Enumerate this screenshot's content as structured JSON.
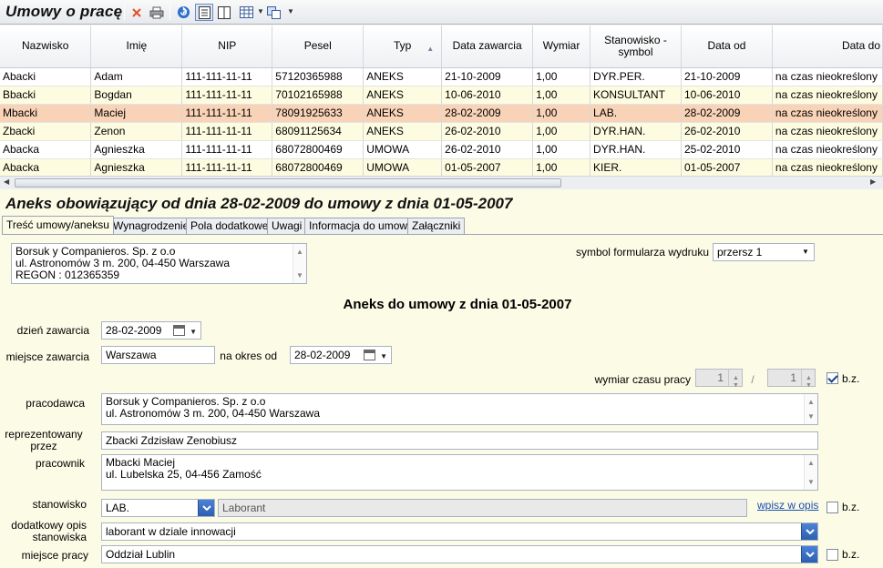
{
  "app_title": "Umowy o pracę",
  "grid": {
    "columns": [
      "Nazwisko",
      "Imię",
      "NIP",
      "Pesel",
      "Typ",
      "Data zawarcia",
      "Wymiar",
      "Stanowisko -\nsymbol",
      "Data od",
      "Data do"
    ],
    "rows": [
      [
        "Abacki",
        "Adam",
        "111-111-11-11",
        "57120365988",
        "ANEKS",
        "21-10-2009",
        "1,00",
        "DYR.PER.",
        "21-10-2009",
        "na czas nieokreślony"
      ],
      [
        "Bbacki",
        "Bogdan",
        "111-111-11-11",
        "70102165988",
        "ANEKS",
        "10-06-2010",
        "1,00",
        "KONSULTANT",
        "10-06-2010",
        "na czas nieokreślony"
      ],
      [
        "Mbacki",
        "Maciej",
        "111-111-11-11",
        "78091925633",
        "ANEKS",
        "28-02-2009",
        "1,00",
        "LAB.",
        "28-02-2009",
        "na czas nieokreślony"
      ],
      [
        "Zbacki",
        "Zenon",
        "111-111-11-11",
        "68091125634",
        "ANEKS",
        "26-02-2010",
        "1,00",
        "DYR.HAN.",
        "26-02-2010",
        "na czas nieokreślony"
      ],
      [
        "Abacka",
        "Agnieszka",
        "111-111-11-11",
        "68072800469",
        "UMOWA",
        "26-02-2010",
        "1,00",
        "DYR.HAN.",
        "25-02-2010",
        "na czas nieokreślony"
      ],
      [
        "Abacka",
        "Agnieszka",
        "111-111-11-11",
        "68072800469",
        "UMOWA",
        "01-05-2007",
        "1,00",
        "KIER.",
        "01-05-2007",
        "na czas nieokreślony"
      ]
    ],
    "selected_row": 2
  },
  "section_title": "Aneks obowiązujący od dnia 28-02-2009 do umowy z dnia 01-05-2007",
  "tabs": [
    "Treść umowy/aneksu",
    "Wynagrodzenie",
    "Pola dodatkowe",
    "Uwagi",
    "Informacja do umowy",
    "Załączniki"
  ],
  "company_box": [
    "Borsuk y Companieros. Sp. z o.o",
    "ul. Astronomów 3 m. 200, 04-450 Warszawa",
    "REGON : 012365359"
  ],
  "print_symbol": {
    "label": "symbol formularza wydruku",
    "value": "przersz 1"
  },
  "heading": "Aneks do umowy z dnia 01-05-2007",
  "form": {
    "dzien_zawarcia_label": "dzień zawarcia",
    "dzien_zawarcia": "28-02-2009",
    "miejsce_zawarcia_label": "miejsce zawarcia",
    "miejsce_zawarcia": "Warszawa",
    "na_okres_od_label": "na okres od",
    "na_okres_od": "28-02-2009",
    "wymiar_label": "wymiar czasu pracy",
    "wymiar_a": "1",
    "wymiar_sep": "/",
    "wymiar_b": "1",
    "bz_label": "b.z.",
    "pracodawca_label": "pracodawca",
    "pracodawca": [
      "Borsuk y Companieros. Sp. z o.o",
      "ul. Astronomów 3 m. 200, 04-450 Warszawa"
    ],
    "reprezentowany_label": "reprezentowany przez",
    "reprezentowany": "Zbacki Zdzisław Zenobiusz",
    "pracownik_label": "pracownik",
    "pracownik": [
      "Mbacki Maciej",
      "ul. Lubelska 25, 04-456 Zamość"
    ],
    "stanowisko_label": "stanowisko",
    "stanowisko_symbol": "LAB.",
    "stanowisko_name": "Laborant",
    "wpisz_link": "wpisz w opis",
    "dodatkowy_label": "dodatkowy opis stanowiska",
    "dodatkowy": "laborant w dziale innowacji",
    "miejsce_pracy_label": "miejsce  pracy",
    "miejsce_pracy": "Oddział Lublin"
  },
  "colors": {
    "accent": "#2a5fb2",
    "selected_row": "#f9d3b8",
    "panel_bg": "#fbfbe6"
  }
}
